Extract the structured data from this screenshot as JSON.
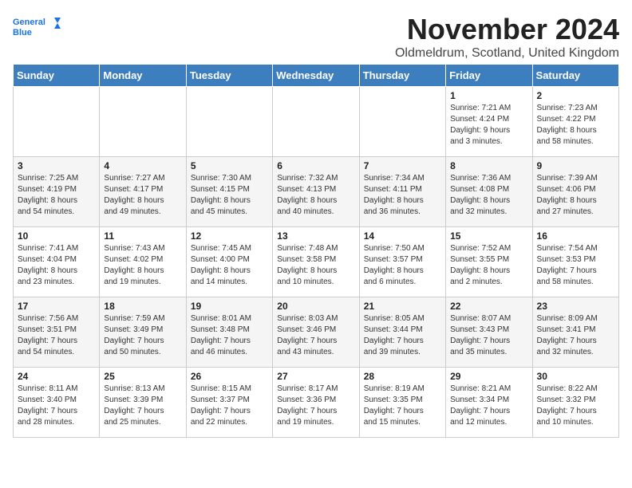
{
  "logo": {
    "line1": "General",
    "line2": "Blue"
  },
  "title": "November 2024",
  "location": "Oldmeldrum, Scotland, United Kingdom",
  "days_of_week": [
    "Sunday",
    "Monday",
    "Tuesday",
    "Wednesday",
    "Thursday",
    "Friday",
    "Saturday"
  ],
  "weeks": [
    [
      {
        "day": "",
        "info": ""
      },
      {
        "day": "",
        "info": ""
      },
      {
        "day": "",
        "info": ""
      },
      {
        "day": "",
        "info": ""
      },
      {
        "day": "",
        "info": ""
      },
      {
        "day": "1",
        "info": "Sunrise: 7:21 AM\nSunset: 4:24 PM\nDaylight: 9 hours\nand 3 minutes."
      },
      {
        "day": "2",
        "info": "Sunrise: 7:23 AM\nSunset: 4:22 PM\nDaylight: 8 hours\nand 58 minutes."
      }
    ],
    [
      {
        "day": "3",
        "info": "Sunrise: 7:25 AM\nSunset: 4:19 PM\nDaylight: 8 hours\nand 54 minutes."
      },
      {
        "day": "4",
        "info": "Sunrise: 7:27 AM\nSunset: 4:17 PM\nDaylight: 8 hours\nand 49 minutes."
      },
      {
        "day": "5",
        "info": "Sunrise: 7:30 AM\nSunset: 4:15 PM\nDaylight: 8 hours\nand 45 minutes."
      },
      {
        "day": "6",
        "info": "Sunrise: 7:32 AM\nSunset: 4:13 PM\nDaylight: 8 hours\nand 40 minutes."
      },
      {
        "day": "7",
        "info": "Sunrise: 7:34 AM\nSunset: 4:11 PM\nDaylight: 8 hours\nand 36 minutes."
      },
      {
        "day": "8",
        "info": "Sunrise: 7:36 AM\nSunset: 4:08 PM\nDaylight: 8 hours\nand 32 minutes."
      },
      {
        "day": "9",
        "info": "Sunrise: 7:39 AM\nSunset: 4:06 PM\nDaylight: 8 hours\nand 27 minutes."
      }
    ],
    [
      {
        "day": "10",
        "info": "Sunrise: 7:41 AM\nSunset: 4:04 PM\nDaylight: 8 hours\nand 23 minutes."
      },
      {
        "day": "11",
        "info": "Sunrise: 7:43 AM\nSunset: 4:02 PM\nDaylight: 8 hours\nand 19 minutes."
      },
      {
        "day": "12",
        "info": "Sunrise: 7:45 AM\nSunset: 4:00 PM\nDaylight: 8 hours\nand 14 minutes."
      },
      {
        "day": "13",
        "info": "Sunrise: 7:48 AM\nSunset: 3:58 PM\nDaylight: 8 hours\nand 10 minutes."
      },
      {
        "day": "14",
        "info": "Sunrise: 7:50 AM\nSunset: 3:57 PM\nDaylight: 8 hours\nand 6 minutes."
      },
      {
        "day": "15",
        "info": "Sunrise: 7:52 AM\nSunset: 3:55 PM\nDaylight: 8 hours\nand 2 minutes."
      },
      {
        "day": "16",
        "info": "Sunrise: 7:54 AM\nSunset: 3:53 PM\nDaylight: 7 hours\nand 58 minutes."
      }
    ],
    [
      {
        "day": "17",
        "info": "Sunrise: 7:56 AM\nSunset: 3:51 PM\nDaylight: 7 hours\nand 54 minutes."
      },
      {
        "day": "18",
        "info": "Sunrise: 7:59 AM\nSunset: 3:49 PM\nDaylight: 7 hours\nand 50 minutes."
      },
      {
        "day": "19",
        "info": "Sunrise: 8:01 AM\nSunset: 3:48 PM\nDaylight: 7 hours\nand 46 minutes."
      },
      {
        "day": "20",
        "info": "Sunrise: 8:03 AM\nSunset: 3:46 PM\nDaylight: 7 hours\nand 43 minutes."
      },
      {
        "day": "21",
        "info": "Sunrise: 8:05 AM\nSunset: 3:44 PM\nDaylight: 7 hours\nand 39 minutes."
      },
      {
        "day": "22",
        "info": "Sunrise: 8:07 AM\nSunset: 3:43 PM\nDaylight: 7 hours\nand 35 minutes."
      },
      {
        "day": "23",
        "info": "Sunrise: 8:09 AM\nSunset: 3:41 PM\nDaylight: 7 hours\nand 32 minutes."
      }
    ],
    [
      {
        "day": "24",
        "info": "Sunrise: 8:11 AM\nSunset: 3:40 PM\nDaylight: 7 hours\nand 28 minutes."
      },
      {
        "day": "25",
        "info": "Sunrise: 8:13 AM\nSunset: 3:39 PM\nDaylight: 7 hours\nand 25 minutes."
      },
      {
        "day": "26",
        "info": "Sunrise: 8:15 AM\nSunset: 3:37 PM\nDaylight: 7 hours\nand 22 minutes."
      },
      {
        "day": "27",
        "info": "Sunrise: 8:17 AM\nSunset: 3:36 PM\nDaylight: 7 hours\nand 19 minutes."
      },
      {
        "day": "28",
        "info": "Sunrise: 8:19 AM\nSunset: 3:35 PM\nDaylight: 7 hours\nand 15 minutes."
      },
      {
        "day": "29",
        "info": "Sunrise: 8:21 AM\nSunset: 3:34 PM\nDaylight: 7 hours\nand 12 minutes."
      },
      {
        "day": "30",
        "info": "Sunrise: 8:22 AM\nSunset: 3:32 PM\nDaylight: 7 hours\nand 10 minutes."
      }
    ]
  ]
}
